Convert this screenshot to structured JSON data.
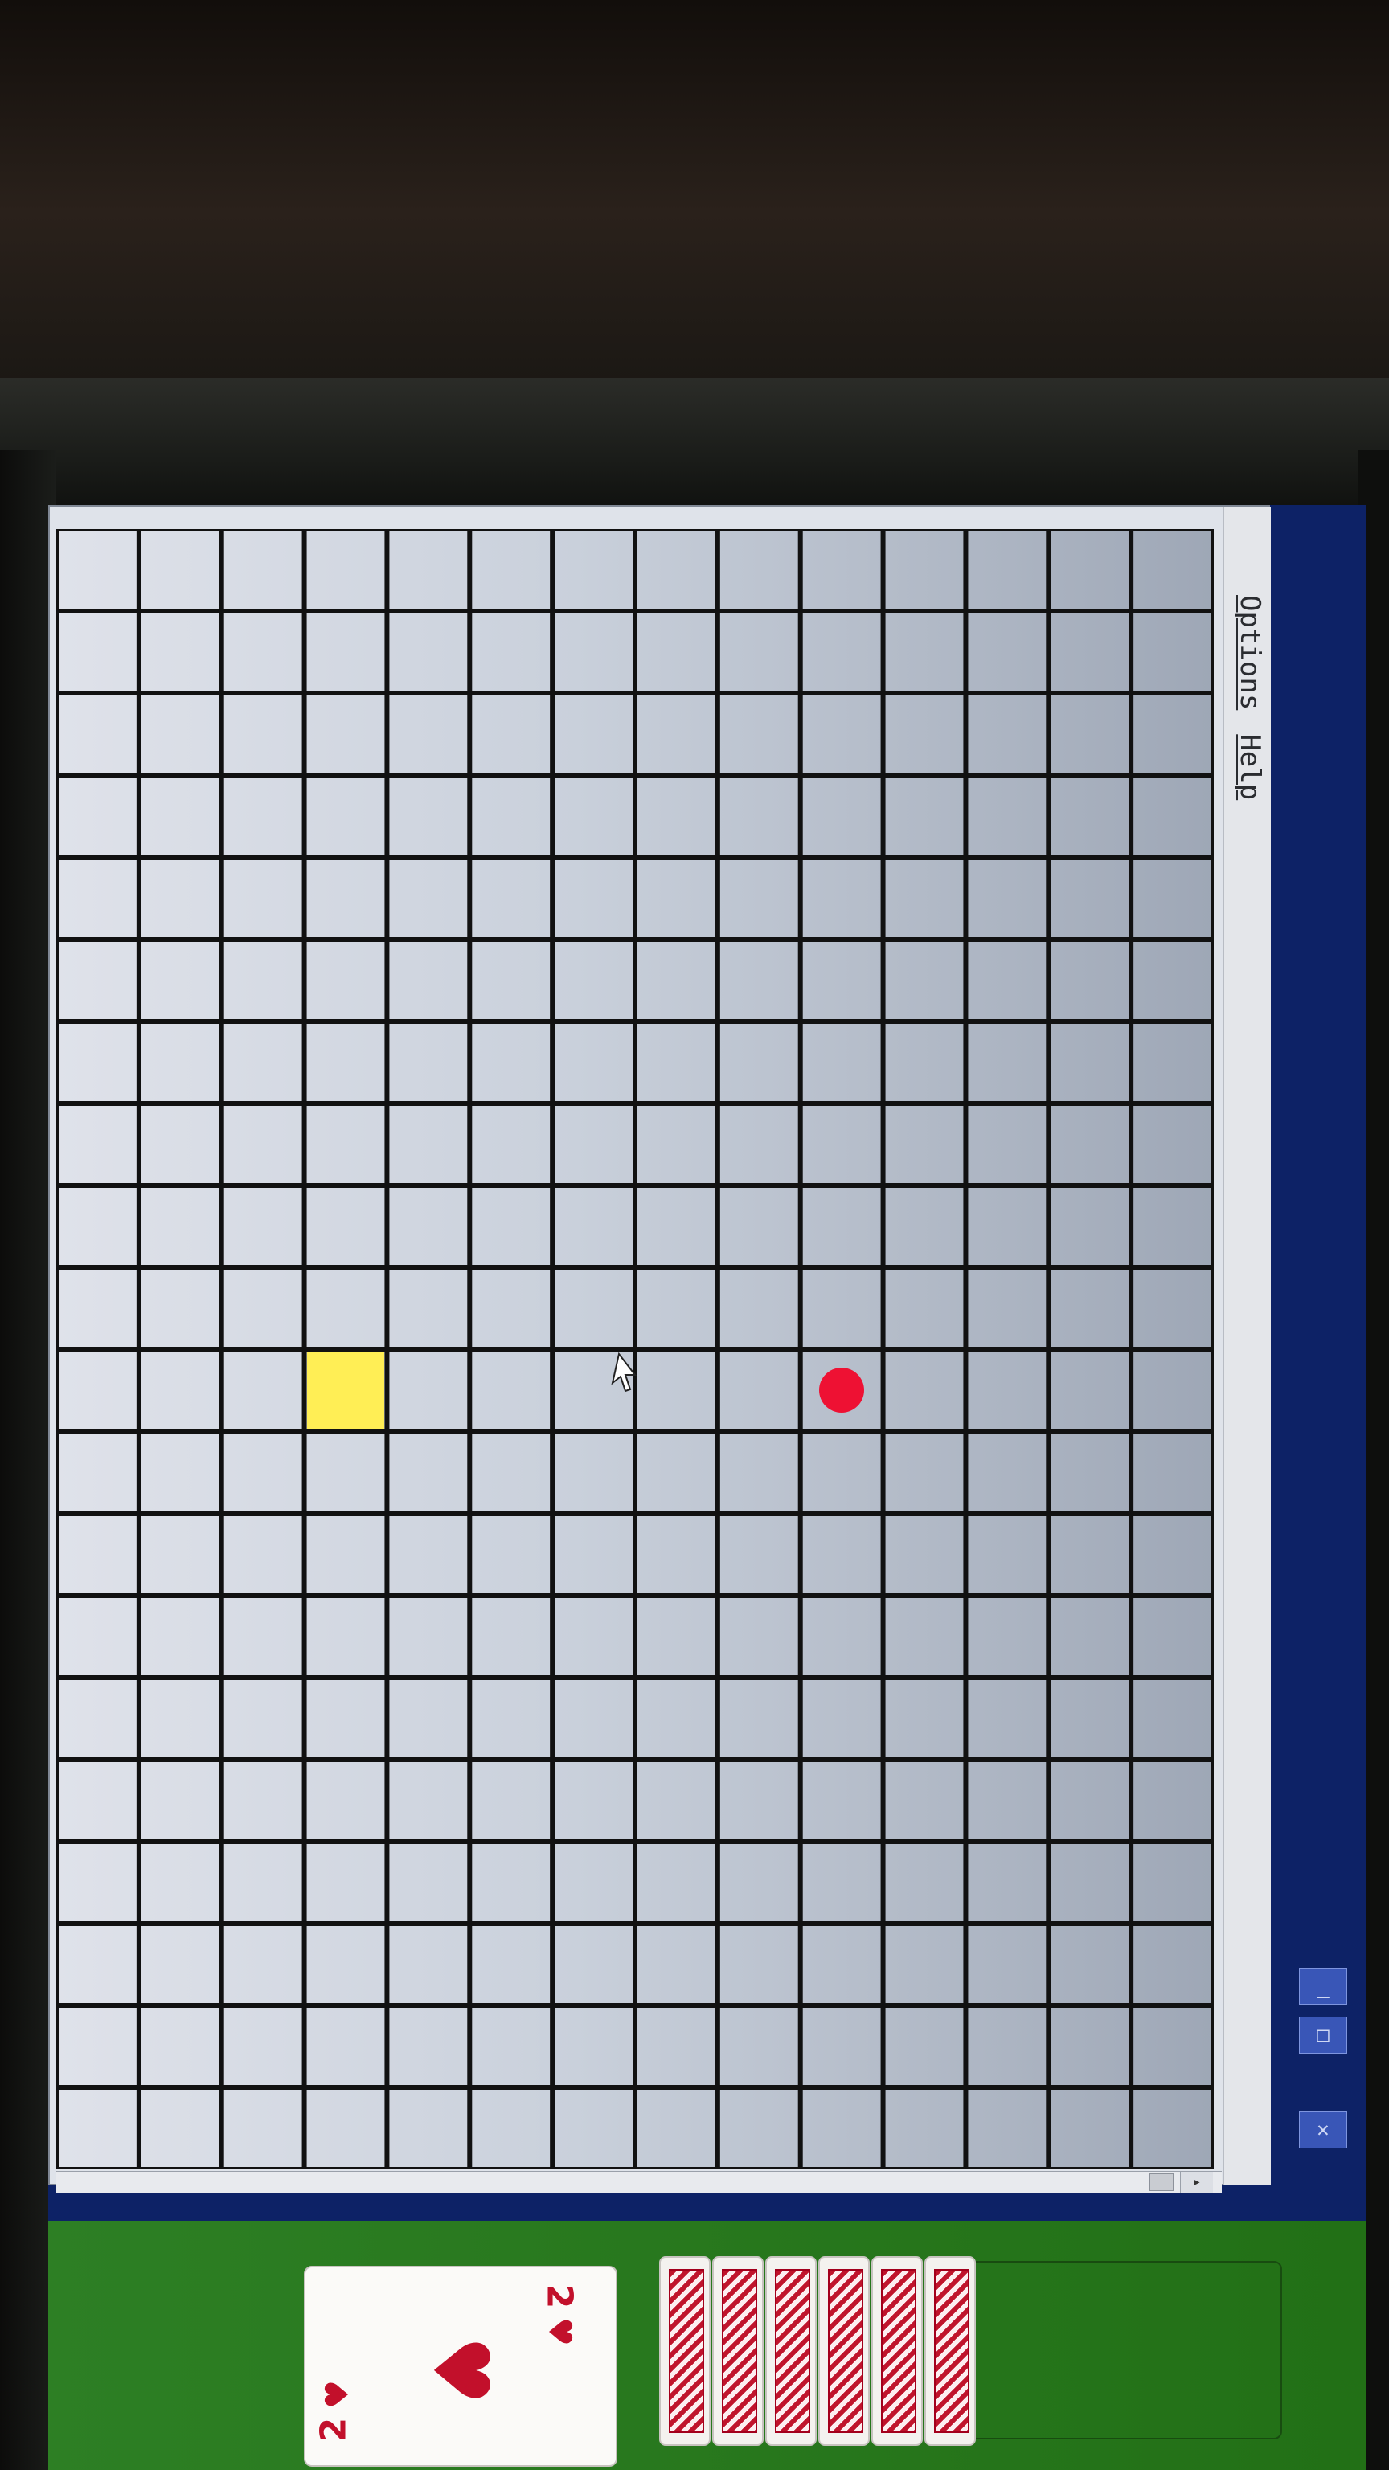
{
  "menu": {
    "items": [
      {
        "label": "Options"
      },
      {
        "label": "Help"
      }
    ]
  },
  "board": {
    "columns": 14,
    "rows": 20,
    "player_color": "#ffee55",
    "food_color": "#ee1133",
    "grid_color": "#111111"
  },
  "titlebar": {
    "buttons": [
      "_",
      "□",
      "✕"
    ]
  },
  "scrollbar": {
    "arrow": "▸"
  },
  "cards": {
    "face_rank": "2",
    "face_suit": "♥",
    "back_count": 6,
    "accent": "#c2102b"
  }
}
